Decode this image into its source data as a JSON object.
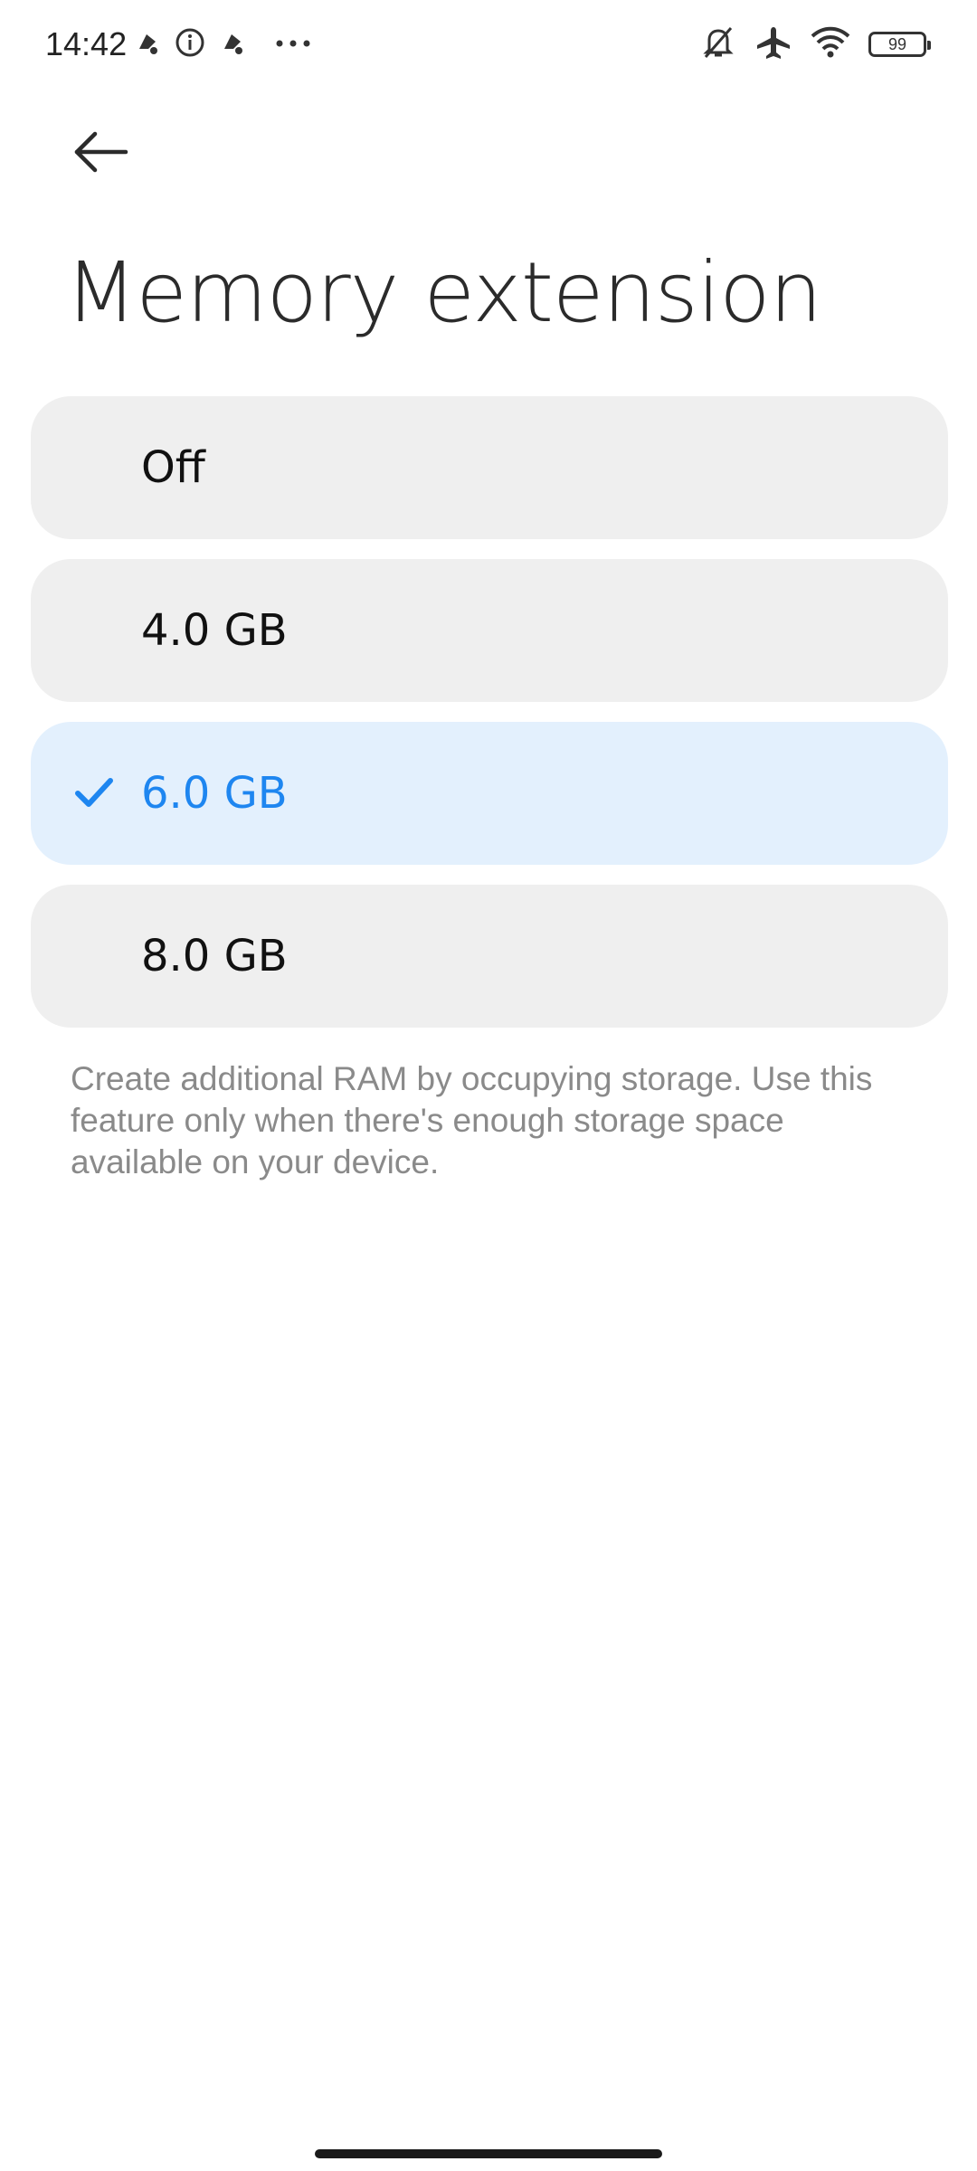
{
  "status_bar": {
    "time": "14:42",
    "left_icons": [
      "notification-icon",
      "info-icon",
      "notification-icon",
      "more-dots-icon"
    ],
    "right_icons": [
      "mute-bell-icon",
      "airplane-icon",
      "wifi-icon"
    ],
    "battery": "99"
  },
  "header": {
    "back_icon": "back-arrow-icon",
    "title": "Memory extension"
  },
  "options": [
    {
      "label": "Off",
      "selected": false
    },
    {
      "label": "4.0 GB",
      "selected": false
    },
    {
      "label": "6.0 GB",
      "selected": true
    },
    {
      "label": "8.0 GB",
      "selected": false
    }
  ],
  "description": "Create additional RAM by occupying storage. Use this feature only when there's enough storage space available on your device.",
  "colors": {
    "accent": "#1e86f0",
    "selected_bg": "#e3f0fd",
    "option_bg": "#efefef",
    "description_text": "#8a8a8a"
  }
}
